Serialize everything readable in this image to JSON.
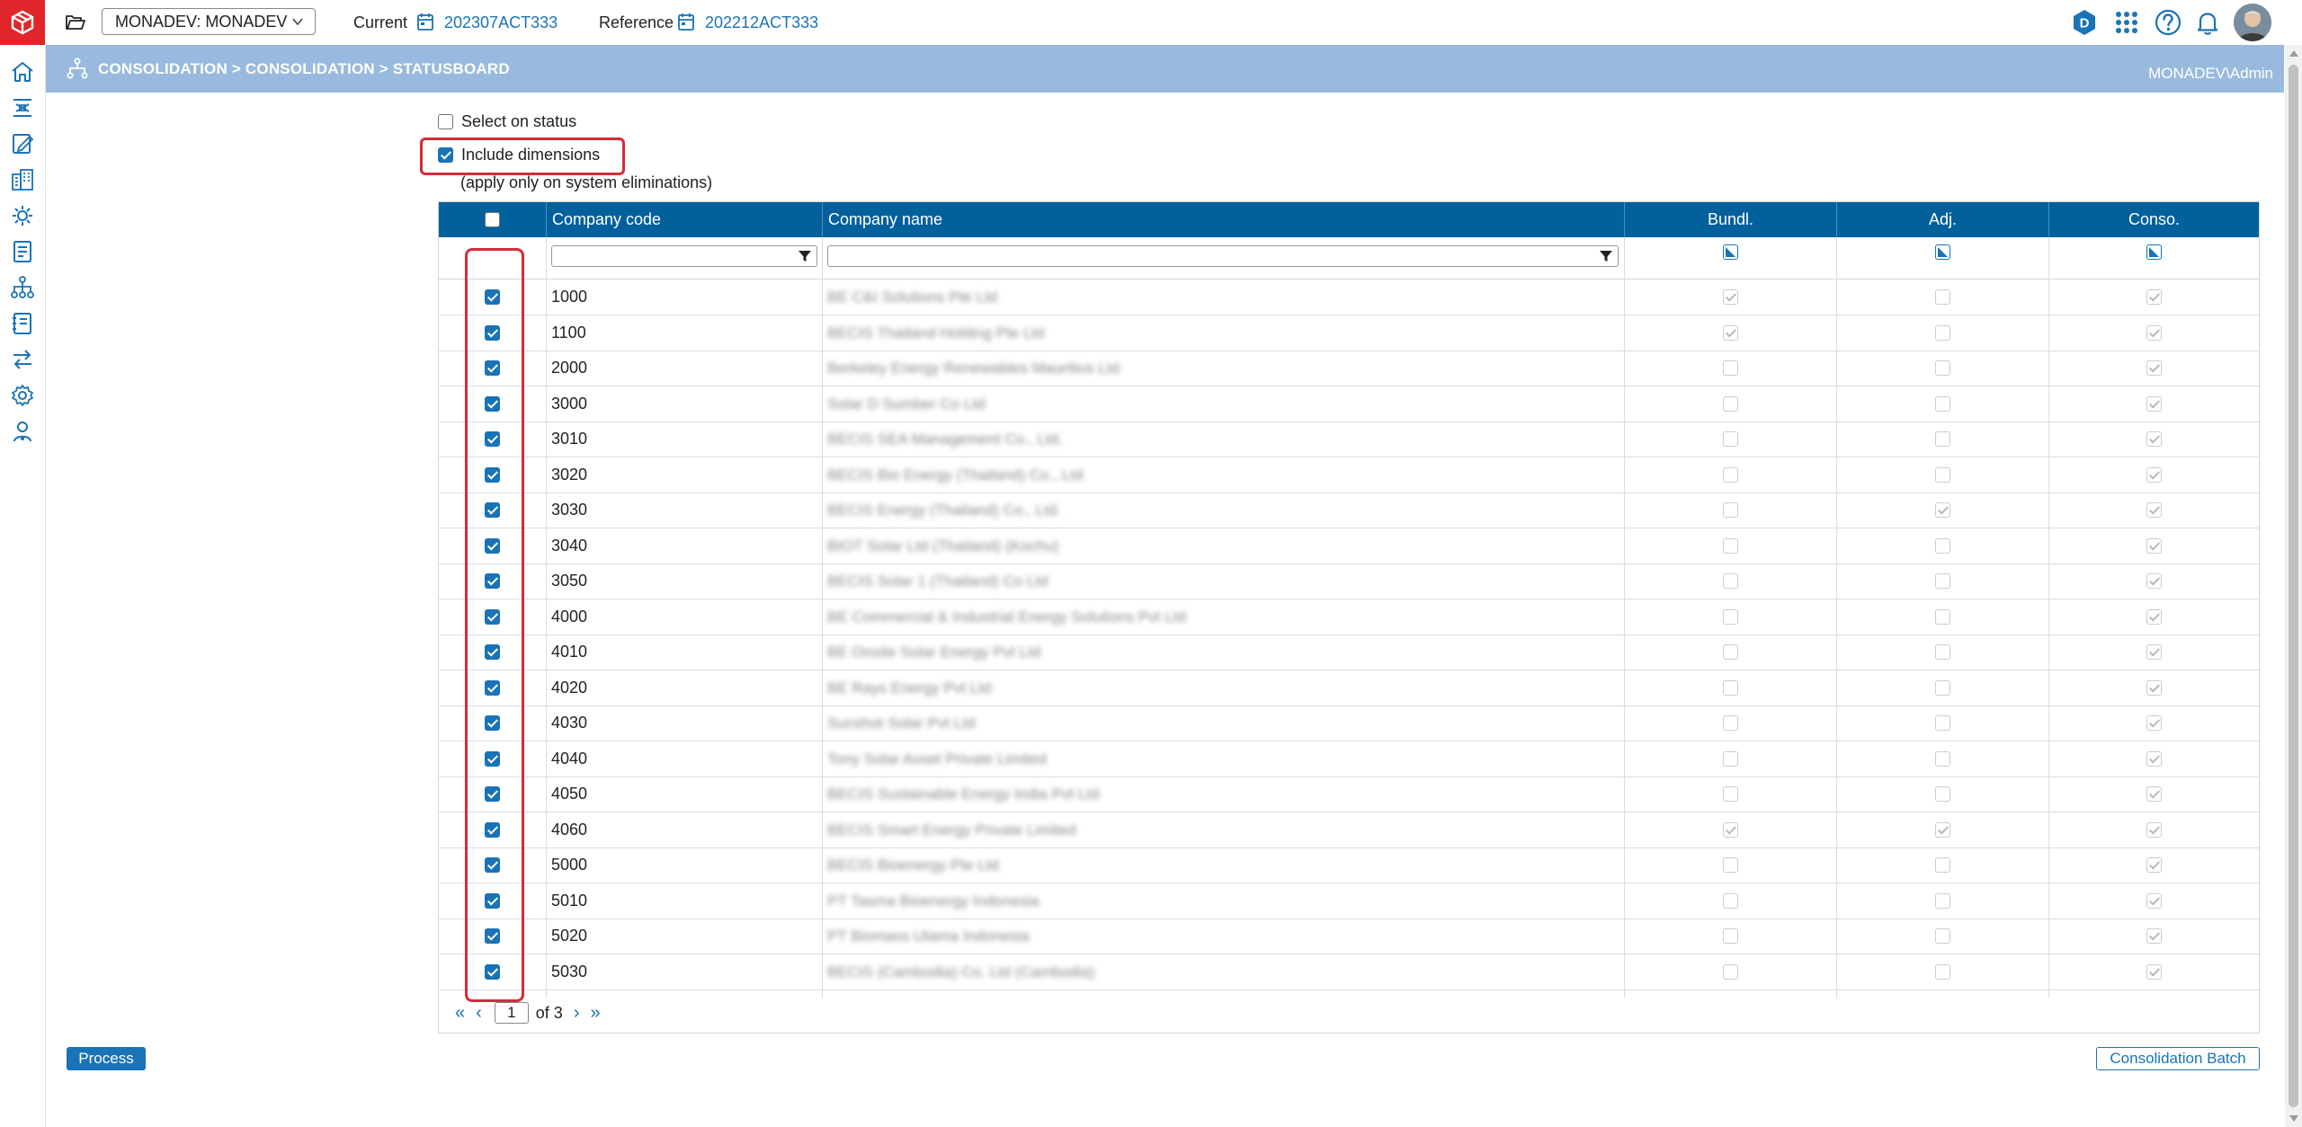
{
  "topbar": {
    "environment": "MONADEV: MONADEV",
    "current_label": "Current",
    "current_value": "202307ACT333",
    "reference_label": "Reference",
    "reference_value": "202212ACT333",
    "badge_letter": "D"
  },
  "breadcrumb": {
    "path": "CONSOLIDATION > CONSOLIDATION > STATUSBOARD",
    "user": "MONADEV\\Admin"
  },
  "options": {
    "select_on_status": "Select on status",
    "include_dimensions": "Include dimensions",
    "note": "(apply only on system eliminations)"
  },
  "table": {
    "columns": [
      "Company code",
      "Company name",
      "Bundl.",
      "Adj.",
      "Conso."
    ],
    "rows": [
      {
        "code": "1000",
        "name": "BE C&I Solutions Pte Ltd",
        "bundl": true,
        "adj": false,
        "conso": true
      },
      {
        "code": "1100",
        "name": "BECIS Thailand Holding Pte Ltd",
        "bundl": true,
        "adj": false,
        "conso": true
      },
      {
        "code": "2000",
        "name": "Berkeley Energy Renewables Mauritius Ltd",
        "bundl": false,
        "adj": false,
        "conso": true
      },
      {
        "code": "3000",
        "name": "Solar D Sumber Co Ltd",
        "bundl": false,
        "adj": false,
        "conso": true
      },
      {
        "code": "3010",
        "name": "BECIS SEA Management Co., Ltd.",
        "bundl": false,
        "adj": false,
        "conso": true
      },
      {
        "code": "3020",
        "name": "BECIS Bio Energy (Thailand) Co., Ltd",
        "bundl": false,
        "adj": false,
        "conso": true
      },
      {
        "code": "3030",
        "name": "BECIS Energy (Thailand) Co., Ltd.",
        "bundl": false,
        "adj": true,
        "conso": true
      },
      {
        "code": "3040",
        "name": "BIOT Solar Ltd (Thailand) (Kochu)",
        "bundl": false,
        "adj": false,
        "conso": true
      },
      {
        "code": "3050",
        "name": "BECIS Solar 1 (Thailand) Co Ltd",
        "bundl": false,
        "adj": false,
        "conso": true
      },
      {
        "code": "4000",
        "name": "BE Commercial & Industrial Energy Solutions Pvt Ltd",
        "bundl": false,
        "adj": false,
        "conso": true
      },
      {
        "code": "4010",
        "name": "BE Onsite Solar Energy Pvt Ltd",
        "bundl": false,
        "adj": false,
        "conso": true
      },
      {
        "code": "4020",
        "name": "BE Rays Energy Pvt Ltd",
        "bundl": false,
        "adj": false,
        "conso": true
      },
      {
        "code": "4030",
        "name": "Sunshot Solar Pvt Ltd",
        "bundl": false,
        "adj": false,
        "conso": true
      },
      {
        "code": "4040",
        "name": "Tony Solar Asset Private Limited",
        "bundl": false,
        "adj": false,
        "conso": true
      },
      {
        "code": "4050",
        "name": "BECIS Sustainable Energy India Pvt Ltd",
        "bundl": false,
        "adj": false,
        "conso": true
      },
      {
        "code": "4060",
        "name": "BECIS Smart Energy Private Limited",
        "bundl": true,
        "adj": true,
        "conso": true
      },
      {
        "code": "5000",
        "name": "BECIS Bioenergy Pte Ltd",
        "bundl": false,
        "adj": false,
        "conso": true
      },
      {
        "code": "5010",
        "name": "PT Tasma Bioenergy Indonesia",
        "bundl": false,
        "adj": false,
        "conso": true
      },
      {
        "code": "5020",
        "name": "PT Biomass Utama Indonesia",
        "bundl": false,
        "adj": false,
        "conso": true
      },
      {
        "code": "5030",
        "name": "BECIS (Cambodia) Co. Ltd (Cambodia)",
        "bundl": false,
        "adj": false,
        "conso": true
      }
    ]
  },
  "pager": {
    "page": "1",
    "of_label": "of 3"
  },
  "buttons": {
    "process": "Process",
    "batch": "Consolidation Batch"
  },
  "colors": {
    "accent": "#1a73b6",
    "header": "#02609d",
    "band": "#99bade",
    "highlight": "#d62b3a",
    "logo": "#e0262b"
  }
}
